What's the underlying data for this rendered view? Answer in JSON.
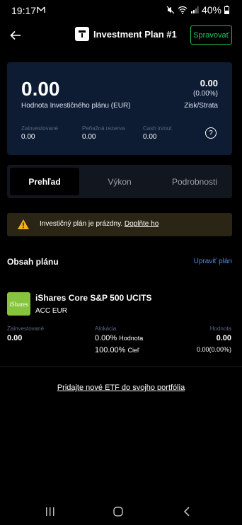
{
  "status_bar": {
    "time": "19:17",
    "battery": "40%"
  },
  "header": {
    "title": "Investment Plan #1",
    "manage_label": "Spravovať"
  },
  "summary": {
    "value": "0.00",
    "value_label": "Hodnota Investičného plánu (EUR)",
    "profit_value": "0.00",
    "profit_percent": "(0.00%)",
    "profit_label": "Zisk/Strata",
    "stats": [
      {
        "label": "Zainvestované",
        "value": "0.00"
      },
      {
        "label": "Peňažná rezerva",
        "value": "0.00"
      },
      {
        "label": "Cash in/out",
        "value": "0.00"
      }
    ],
    "help": "?"
  },
  "tabs": [
    {
      "label": "Prehľad",
      "active": true
    },
    {
      "label": "Výkon",
      "active": false
    },
    {
      "label": "Podrobnosti",
      "active": false
    }
  ],
  "notice": {
    "text": "Investičný plán je prázdny.",
    "link": "Doplňte ho",
    "icon": "warning-icon",
    "color": "#2b2515"
  },
  "plan_contents": {
    "title": "Obsah plánu",
    "edit_label": "Upraviť plán"
  },
  "etf": {
    "logo_text": "iShares",
    "logo_color": "#86c440",
    "name": "iShares Core S&P 500 UCITS",
    "sub": "ACC EUR",
    "invested_label": "Zainvestované",
    "invested_value": "0.00",
    "allocation_label": "Alokácia",
    "allocation_value": "0.00%",
    "allocation_value_label": "Hodnota",
    "allocation_target": "100.00%",
    "allocation_target_label": "Cieľ",
    "value_label": "Hodnota",
    "value": "0.00",
    "value_change": "0.00(0.00%)"
  },
  "add_etf_label": "Pridajte nové ETF do svojho portfólia",
  "colors": {
    "accent_green": "#27c65c",
    "link_blue": "#4a8fe0",
    "card_bg": "#0d1b33"
  }
}
